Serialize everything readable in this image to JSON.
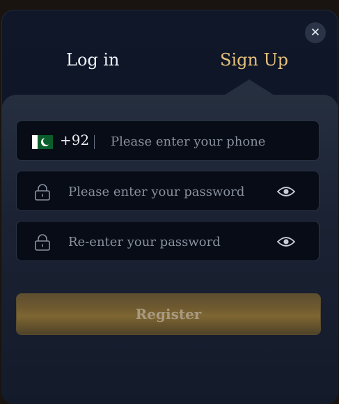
{
  "tabs": {
    "login_label": "Log in",
    "signup_label": "Sign Up",
    "active": "Sign Up"
  },
  "close_label": "✕",
  "phone": {
    "country_flag": "pakistan-flag-icon",
    "country_code": "+92",
    "value": "",
    "placeholder": "Please enter your phone"
  },
  "password": {
    "value": "",
    "placeholder": "Please enter your password"
  },
  "confirm_password": {
    "value": "",
    "placeholder": "Re-enter your password"
  },
  "register_label": "Register",
  "colors": {
    "accent": "#e8c07a",
    "panel": "#1a2233",
    "field": "#070c16",
    "button": "#7e6632"
  }
}
